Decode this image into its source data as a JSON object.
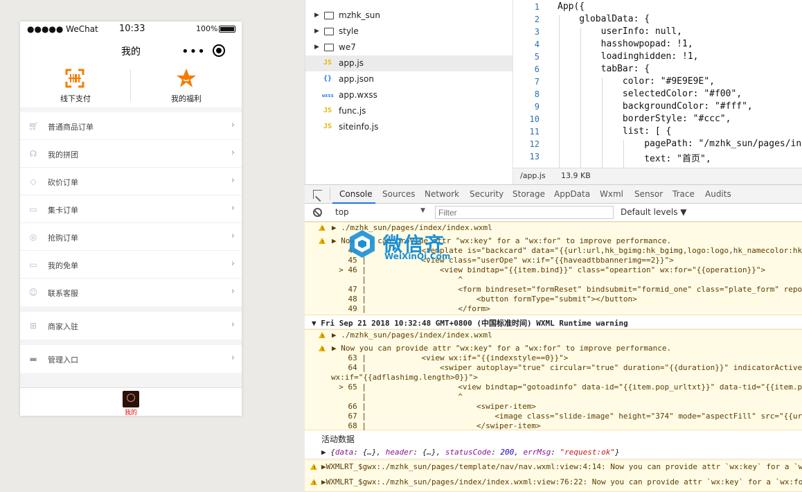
{
  "simulator": {
    "status": {
      "carrier": "●●●●● WeChat",
      "time": "10:33",
      "battery": "100%"
    },
    "nav": {
      "title": "我的"
    },
    "quick_actions": [
      {
        "label": "线下支付",
        "icon": "qr-scan-icon"
      },
      {
        "label": "我的福利",
        "icon": "star-icon"
      }
    ],
    "menu_group_1": [
      {
        "label": "普通商品订单",
        "icon": "cart-icon"
      },
      {
        "label": "我的拼团",
        "icon": "group-icon"
      },
      {
        "label": "砍价订单",
        "icon": "tag-icon"
      },
      {
        "label": "集卡订单",
        "icon": "card-icon"
      },
      {
        "label": "抢购订单",
        "icon": "flash-icon"
      },
      {
        "label": "我的免单",
        "icon": "ticket-icon"
      },
      {
        "label": "联系客服",
        "icon": "service-icon"
      }
    ],
    "menu_group_2": [
      {
        "label": "商家入驻",
        "icon": "gift-icon"
      }
    ],
    "menu_group_3": [
      {
        "label": "管理入口",
        "icon": "admin-icon"
      }
    ],
    "tabbar": {
      "label": "我的",
      "active_color": "#f00"
    }
  },
  "file_tree": [
    {
      "name": "mzhk_sun",
      "type": "folder"
    },
    {
      "name": "style",
      "type": "folder"
    },
    {
      "name": "we7",
      "type": "folder"
    },
    {
      "name": "app.js",
      "type": "js",
      "selected": true
    },
    {
      "name": "app.json",
      "type": "json"
    },
    {
      "name": "app.wxss",
      "type": "wxss"
    },
    {
      "name": "func.js",
      "type": "js"
    },
    {
      "name": "siteinfo.js",
      "type": "js"
    }
  ],
  "editor": {
    "lines": [
      {
        "n": "1",
        "code": "App({"
      },
      {
        "n": "2",
        "code": "    globalData: {"
      },
      {
        "n": "3",
        "code": "        userInfo: null,"
      },
      {
        "n": "4",
        "code": "        hasshowpopad: !1,"
      },
      {
        "n": "5",
        "code": "        loadinghidden: !1,"
      },
      {
        "n": "6",
        "code": "        tabBar: {"
      },
      {
        "n": "7",
        "code": "            color: \"#9E9E9E\","
      },
      {
        "n": "8",
        "code": "            selectedColor: \"#f00\","
      },
      {
        "n": "9",
        "code": "            backgroundColor: \"#fff\","
      },
      {
        "n": "10",
        "code": "            borderStyle: \"#ccc\","
      },
      {
        "n": "11",
        "code": "            list: [ {"
      },
      {
        "n": "12",
        "code": "                pagePath: \"/mzhk_sun/pages/ind"
      },
      {
        "n": "13",
        "code": "                text: \"首页\","
      }
    ],
    "status": {
      "path": "/app.js",
      "size": "13.9 KB"
    }
  },
  "devtools": {
    "tabs": [
      "Console",
      "Sources",
      "Network",
      "Security",
      "Storage",
      "AppData",
      "Wxml",
      "Sensor",
      "Trace",
      "Audits"
    ],
    "active_tab": "Console",
    "context": "top",
    "filter_placeholder": "Filter",
    "levels": "Default levels"
  },
  "console": {
    "block1": {
      "path": "▶ ./mzhk_sun/pages/index/index.wxml",
      "msg": "▶ Now you can provide attr \"wx:key\" for a \"wx:for\" to improve performance.",
      "lines": [
        "    44 |            <template is=\"backcard\" data=\"{{url:url,hk_bgimg:hk_bgimg,logo:logo,hk_namecolor:hk_",
        "    45 |            <view class=\"userOpe\" wx:if=\"{{haveadtbbannerimg==2}}\">",
        "  > 46 |                <view bindtap=\"{{item.bind}}\" class=\"opeartion\" wx:for=\"{{operation}}\">",
        "       |                    ^",
        "    47 |                    <form bindreset=\"formReset\" bindsubmit=\"formid_one\" class=\"plate_form\" repor",
        "    48 |                        <button formType=\"submit\"></button>",
        "    49 |                    </form>"
      ]
    },
    "group_head": "▼ Fri Sep 21 2018 10:32:48 GMT+0800 (中国标准时间) WXML Runtime warning",
    "block2": {
      "path": "▶ ./mzhk_sun/pages/index/index.wxml",
      "msg": "▶ Now you can provide attr \"wx:key\" for a \"wx:for\" to improve performance.",
      "lines": [
        "    63 |            <view wx:if=\"{{indexstyle==0}}\">",
        "    64 |                <swiper autoplay=\"true\" circular=\"true\" duration=\"{{duration}}\" indicatorActiveC",
        "wx:if=\"{{adflashimg.length>0}}\">",
        "  > 65 |                    <view bindtap=\"gotoadinfo\" data-id=\"{{item.pop_urltxt}}\" data-tid=\"{{item.po",
        "       |                    ^",
        "    66 |                        <swiper-item>",
        "    67 |                            <image class=\"slide-image\" height=\"374\" mode=\"aspectFill\" src=\"{{url",
        "    68 |                        </swiper-item>"
      ]
    },
    "log_title": "活动数据",
    "log_obj": {
      "prefix": "▶ {",
      "k1": "data",
      "v1": "{…}",
      "k2": "header",
      "v2": "{…}",
      "k3": "statusCode",
      "v3": "200",
      "k4": "errMsg",
      "v4": "\"request:ok\"",
      "suffix": "}"
    },
    "warn3": "▶WXMLRT_$gwx:./mzhk_sun/pages/template/nav/nav.wxml:view:4:14: Now you can provide attr `wx:key` for a `w",
    "warn4": "▶WXMLRT_$gwx:./mzhk_sun/pages/index/index.wxml:view:76:22: Now you can provide attr `wx:key` for a `wx:fo"
  },
  "watermark": {
    "cn": "微信齐",
    "en": "WeiXinQi.Com"
  },
  "colors": {
    "accent": "#f57c00",
    "link_blue": "#1a73e8",
    "warning_bg": "#fffbe5"
  }
}
